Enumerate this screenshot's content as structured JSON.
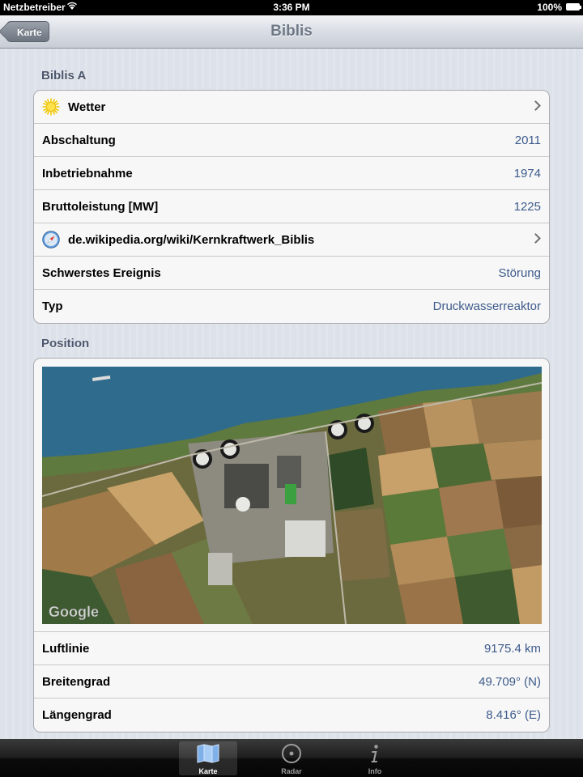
{
  "status_bar": {
    "carrier": "Netzbetreiber",
    "time": "3:36 PM",
    "battery": "100%"
  },
  "nav": {
    "back_label": "Karte",
    "title": "Biblis"
  },
  "section1": {
    "header": "Biblis A",
    "rows": [
      {
        "label": "Wetter",
        "icon": "sun-icon",
        "disclosure": true
      },
      {
        "label": "Abschaltung",
        "value": "2011"
      },
      {
        "label": "Inbetriebnahme",
        "value": "1974"
      },
      {
        "label": "Bruttoleistung [MW]",
        "value": "1225"
      },
      {
        "label": "de.wikipedia.org/wiki/Kernkraftwerk_Biblis",
        "icon": "safari-compass-icon",
        "disclosure": true
      },
      {
        "label": "Schwerstes Ereignis",
        "value": "Störung"
      },
      {
        "label": "Typ",
        "value": "Druckwasserreaktor"
      }
    ]
  },
  "section2": {
    "header": "Position",
    "map_watermark": "Google",
    "rows": [
      {
        "label": "Luftlinie",
        "value": "9175.4 km"
      },
      {
        "label": "Breitengrad",
        "value": "49.709° (N)"
      },
      {
        "label": "Längengrad",
        "value": "8.416° (E)"
      }
    ]
  },
  "tabs": [
    {
      "label": "Karte",
      "icon": "map-icon",
      "active": true
    },
    {
      "label": "Radar",
      "icon": "radar-icon",
      "active": false
    },
    {
      "label": "Info",
      "icon": "info-icon",
      "active": false
    }
  ],
  "colors": {
    "value_text": "#3d5b8b",
    "section_header": "#4c566c",
    "nav_title": "#6f7886"
  }
}
